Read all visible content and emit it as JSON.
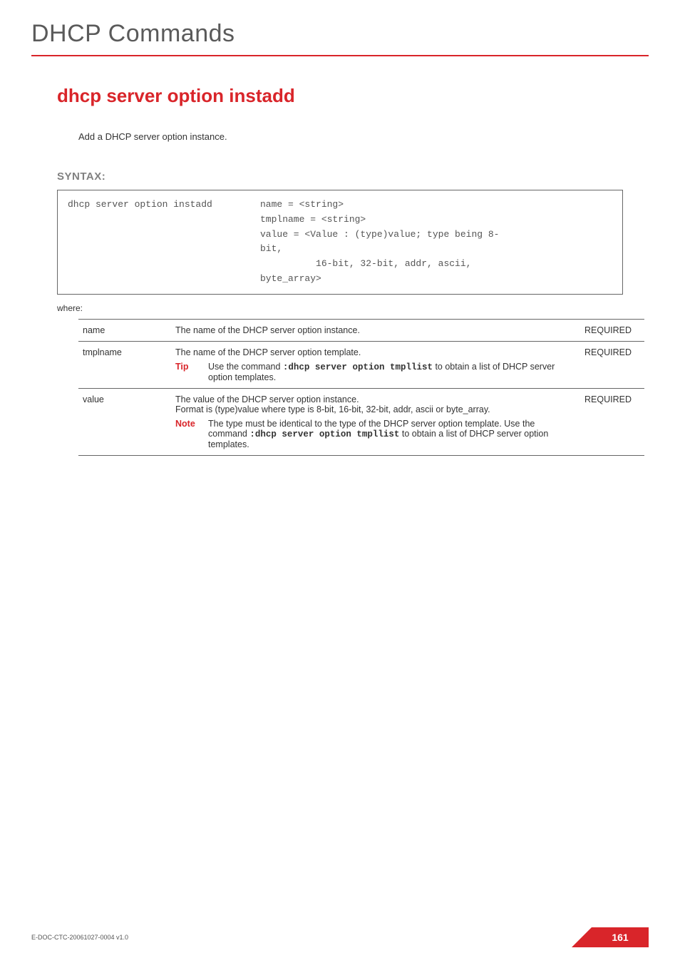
{
  "header": {
    "title": "DHCP Commands"
  },
  "command": {
    "title": "dhcp server option instadd",
    "description": "Add a DHCP server option instance."
  },
  "syntax": {
    "label": "SYNTAX:",
    "left": "dhcp server option instadd",
    "right": "name = <string>\ntmplname = <string>\nvalue = <Value : (type)value; type being 8-\nbit,\n          16-bit, 32-bit, addr, ascii,\nbyte_array>"
  },
  "where_label": "where:",
  "params": [
    {
      "name": "name",
      "desc": "The name of the DHCP server option instance.",
      "req": "REQUIRED"
    },
    {
      "name": "tmplname",
      "desc": "The name of the DHCP server option template.",
      "req": "REQUIRED",
      "tip_label": "Tip",
      "tip_pre": "Use the command ",
      "tip_code": ":dhcp server option tmpllist",
      "tip_post": " to obtain a list of DHCP server option templates."
    },
    {
      "name": "value",
      "desc": "The value of the DHCP server option instance.",
      "desc2": "Format is (type)value where type is 8-bit, 16-bit, 32-bit, addr, ascii or byte_array.",
      "req": "REQUIRED",
      "note_label": "Note",
      "note_pre": "The type must be identical to the type of the DHCP server option template. Use the command ",
      "note_code": ":dhcp server option tmpllist",
      "note_post": " to obtain a list of DHCP server option templates."
    }
  ],
  "footer": {
    "docid": "E-DOC-CTC-20061027-0004 v1.0",
    "page": "161"
  }
}
